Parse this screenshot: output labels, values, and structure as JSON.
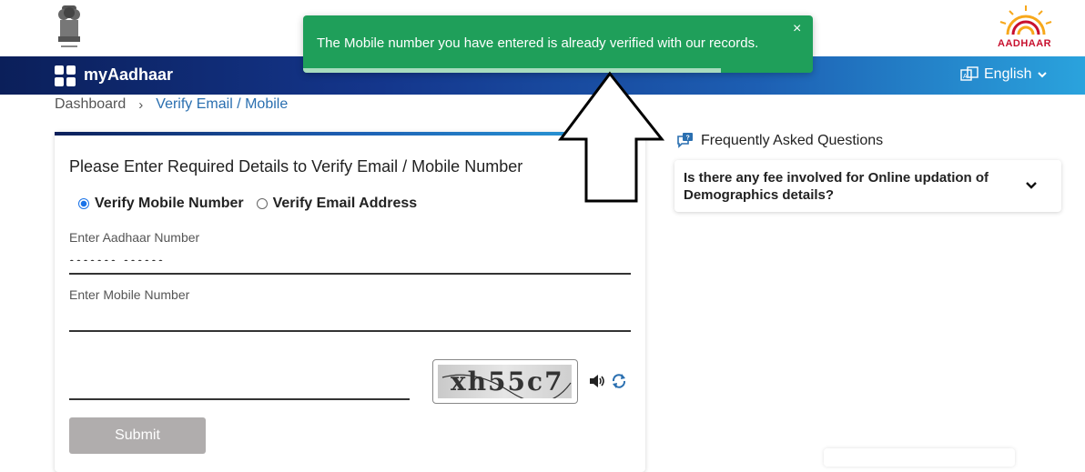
{
  "header": {
    "brand_name": "myAadhaar",
    "aadhaar_logo_text": "AADHAAR",
    "language": "English",
    "emblem_icon": "state-emblem-icon",
    "lang_icon": "translate-icon"
  },
  "breadcrumb": {
    "home": "Dashboard",
    "separator": "›",
    "current": "Verify Email / Mobile"
  },
  "form": {
    "title": "Please Enter Required Details to Verify Email / Mobile Number",
    "radio_mobile_label": "Verify Mobile Number",
    "radio_email_label": "Verify Email Address",
    "selected_option": "Verify Mobile Number",
    "aadhaar_label": "Enter Aadhaar Number",
    "aadhaar_value": "••••••• ••••••",
    "mobile_label": "Enter Mobile Number",
    "mobile_value": "",
    "captcha_value": "",
    "captcha_text": "xh55c7",
    "submit_label": "Submit"
  },
  "faq": {
    "heading": "Frequently Asked Questions",
    "question": "Is there any fee involved for Online updation of Demographics details?"
  },
  "toast": {
    "message": "The Mobile number you have entered is already verified with our records.",
    "close_label": "×",
    "progress_fraction": 0.82,
    "color": "#1f9f5a"
  },
  "colors": {
    "accent": "#2a6fb0",
    "nav_dark": "#0b1f5a",
    "nav_light": "#2aa3dd",
    "button_disabled": "#b0adad"
  }
}
